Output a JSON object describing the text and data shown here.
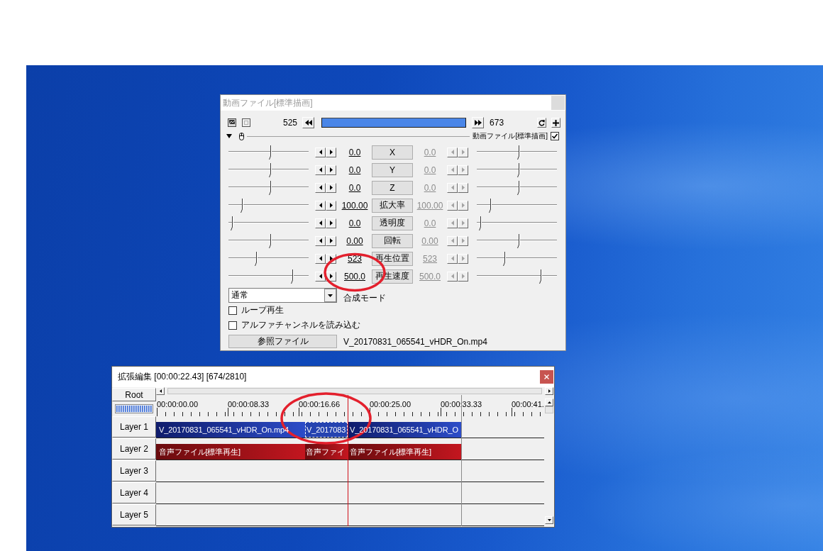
{
  "object_dialog": {
    "title": "動画ファイル[標準描画]",
    "start_frame": "525",
    "end_frame": "673",
    "section_label": "動画ファイル[標準描画]",
    "section_enabled": true,
    "params": [
      {
        "label": "X",
        "start": {
          "value": "0.0",
          "level": 0.53,
          "disabled": false
        },
        "end": {
          "value": "0.0",
          "level": 0.53,
          "disabled": true
        }
      },
      {
        "label": "Y",
        "start": {
          "value": "0.0",
          "level": 0.53,
          "disabled": false
        },
        "end": {
          "value": "0.0",
          "level": 0.53,
          "disabled": true
        }
      },
      {
        "label": "Z",
        "start": {
          "value": "0.0",
          "level": 0.53,
          "disabled": false
        },
        "end": {
          "value": "0.0",
          "level": 0.53,
          "disabled": true
        }
      },
      {
        "label": "拡大率",
        "start": {
          "value": "100.00",
          "level": 0.14,
          "disabled": false
        },
        "end": {
          "value": "100.00",
          "level": 0.14,
          "disabled": true
        }
      },
      {
        "label": "透明度",
        "start": {
          "value": "0.0",
          "level": 0,
          "disabled": false
        },
        "end": {
          "value": "0.0",
          "level": 0,
          "disabled": true
        }
      },
      {
        "label": "回転",
        "start": {
          "value": "0.00",
          "level": 0.53,
          "disabled": false
        },
        "end": {
          "value": "0.00",
          "level": 0.53,
          "disabled": true
        }
      },
      {
        "label": "再生位置",
        "start": {
          "value": "523",
          "level": 0.33,
          "disabled": false
        },
        "end": {
          "value": "523",
          "level": 0.33,
          "disabled": true
        }
      },
      {
        "label": "再生速度",
        "start": {
          "value": "500.0",
          "level": 0.83,
          "disabled": false
        },
        "end": {
          "value": "500.0",
          "level": 0.83,
          "disabled": true
        }
      }
    ],
    "blend_mode": {
      "value": "通常",
      "label": "合成モード"
    },
    "options": [
      {
        "label": "ループ再生",
        "checked": false
      },
      {
        "label": "アルファチャンネルを読み込む",
        "checked": false
      }
    ],
    "file_button": "参照ファイル",
    "file_name": "V_20170831_065541_vHDR_On.mp4"
  },
  "timeline": {
    "title": "拡張編集 [00:00:22.43] [674/2810]",
    "root_button": "Root",
    "ruler_labels": [
      "00:00:00.00",
      "00:00:08.33",
      "00:00:16.66",
      "00:00:25.00",
      "00:00:33.33",
      "00:00:41."
    ],
    "layers": [
      {
        "label": "Layer 1",
        "clips": [
          {
            "kind": "video",
            "label": "V_20170831_065541_vHDR_On.mp4",
            "selected": false
          },
          {
            "kind": "video",
            "label": "V_2017083",
            "selected": true
          },
          {
            "kind": "video",
            "label": "V_20170831_065541_vHDR_O",
            "selected": false
          }
        ]
      },
      {
        "label": "Layer 2",
        "clips": [
          {
            "kind": "audio",
            "label": "音声ファイル[標準再生]",
            "selected": false
          },
          {
            "kind": "audio",
            "label": "音声ファイ",
            "selected": false
          },
          {
            "kind": "audio",
            "label": "音声ファイル[標準再生]",
            "selected": false
          }
        ]
      },
      {
        "label": "Layer 3"
      },
      {
        "label": "Layer 4"
      },
      {
        "label": "Layer 5"
      }
    ]
  }
}
